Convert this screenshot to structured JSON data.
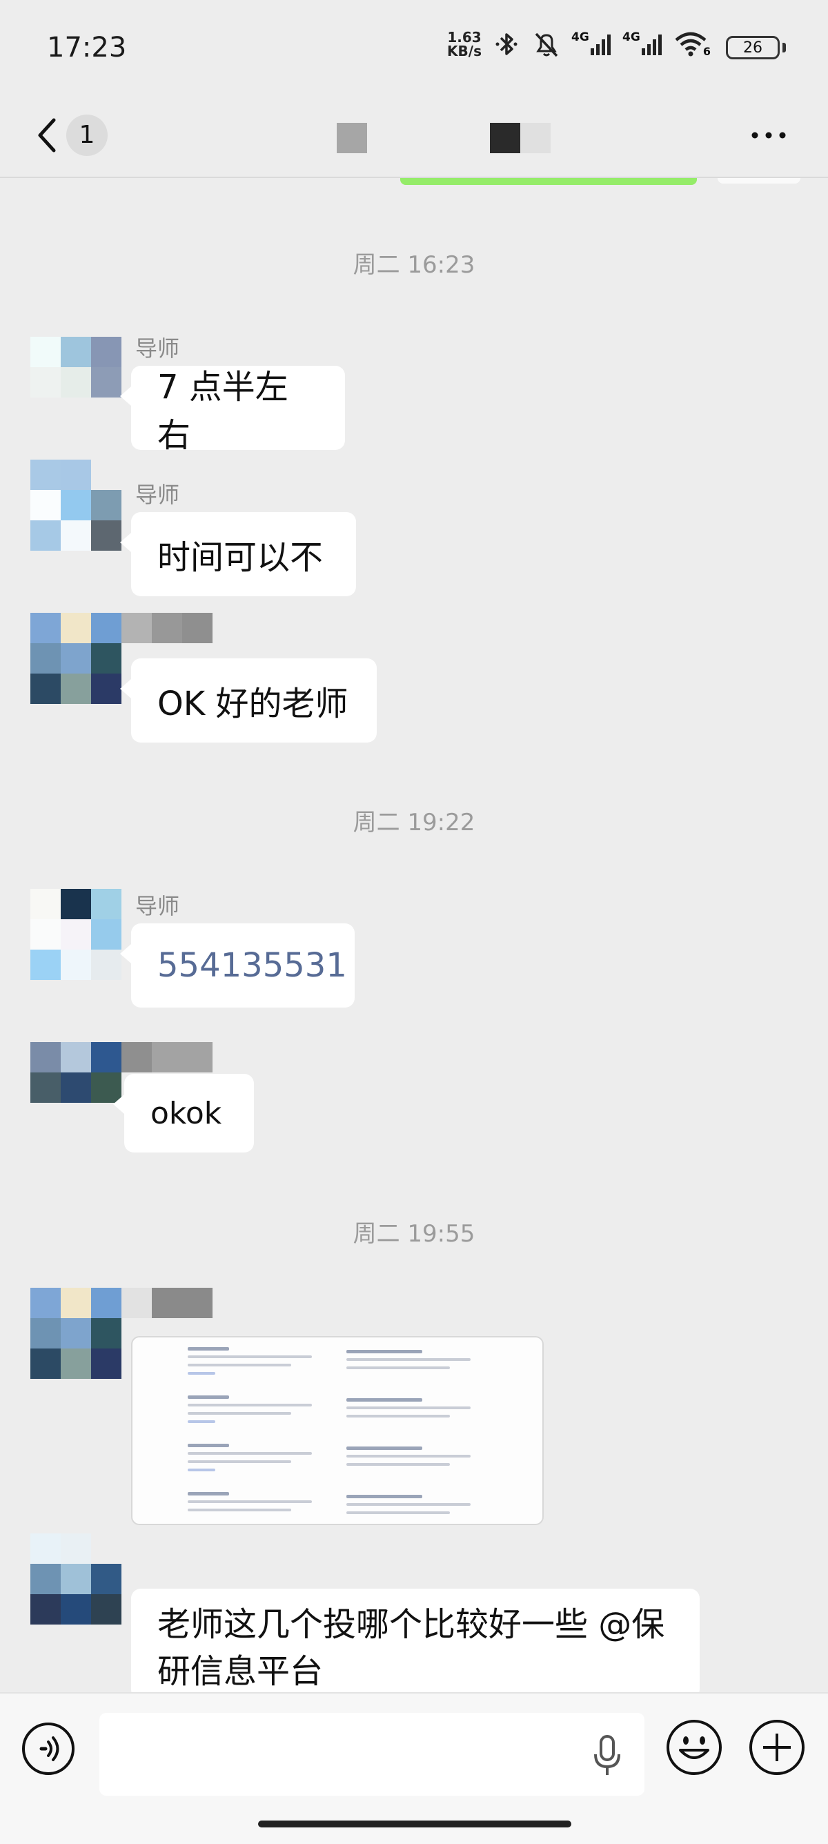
{
  "status_bar": {
    "time": "17:23",
    "net_speed_value": "1.63",
    "net_speed_unit": "KB/s",
    "signal_label_1": "4G",
    "signal_label_2": "4G",
    "wifi_label": "6",
    "battery": "26"
  },
  "header": {
    "unread_count": "1",
    "back_icon": "chevron-left-icon",
    "more_icon": "more-dots-icon"
  },
  "chat": {
    "timestamps": [
      "周二 16:23",
      "周二 19:22",
      "周二 19:55"
    ],
    "messages": [
      {
        "sender": "导师",
        "text": "7 点半左右"
      },
      {
        "sender": "导师",
        "text": "时间可以不"
      },
      {
        "sender": "",
        "text": "OK 好的老师"
      },
      {
        "sender": "导师",
        "text": "554135531"
      },
      {
        "sender": "",
        "text": "okok"
      },
      {
        "sender": "",
        "text": "老师这几个投哪个比较好一些 @保研信息平台"
      }
    ]
  },
  "input_bar": {
    "placeholder": "",
    "voice_icon": "voice-icon",
    "mic_icon": "microphone-icon",
    "emoji_icon": "emoji-icon",
    "plus_icon": "plus-icon"
  },
  "colors": {
    "background": "#ededed",
    "bubble": "#ffffff",
    "link": "#576b95",
    "sent_bubble": "#95ec69"
  }
}
